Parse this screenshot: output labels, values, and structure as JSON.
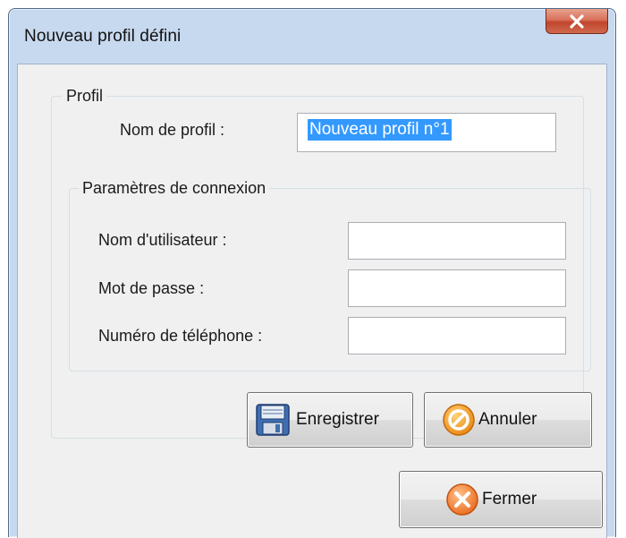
{
  "window": {
    "title": "Nouveau profil défini",
    "close_glyph": "X"
  },
  "profile_group": {
    "label": "Profil",
    "name_label": "Nom de profil :",
    "name_value": "Nouveau profil n°1"
  },
  "connection_group": {
    "label": "Paramètres de connexion",
    "username_label": "Nom d'utilisateur :",
    "username_value": "",
    "password_label": "Mot de passe :",
    "password_value": "",
    "phone_label": "Numéro de téléphone :",
    "phone_value": ""
  },
  "buttons": {
    "save_label": "Enregistrer",
    "cancel_label": "Annuler",
    "close_label": "Fermer"
  },
  "icons": {
    "save": "floppy-disk-icon",
    "cancel": "cancel-circle-icon",
    "close": "close-circle-icon",
    "window_close": "close-x-icon"
  },
  "colors": {
    "selection": "#3399ff",
    "title_close": "#c7503a",
    "cancel_icon": "#f0a030",
    "close_icon": "#f07a30"
  }
}
